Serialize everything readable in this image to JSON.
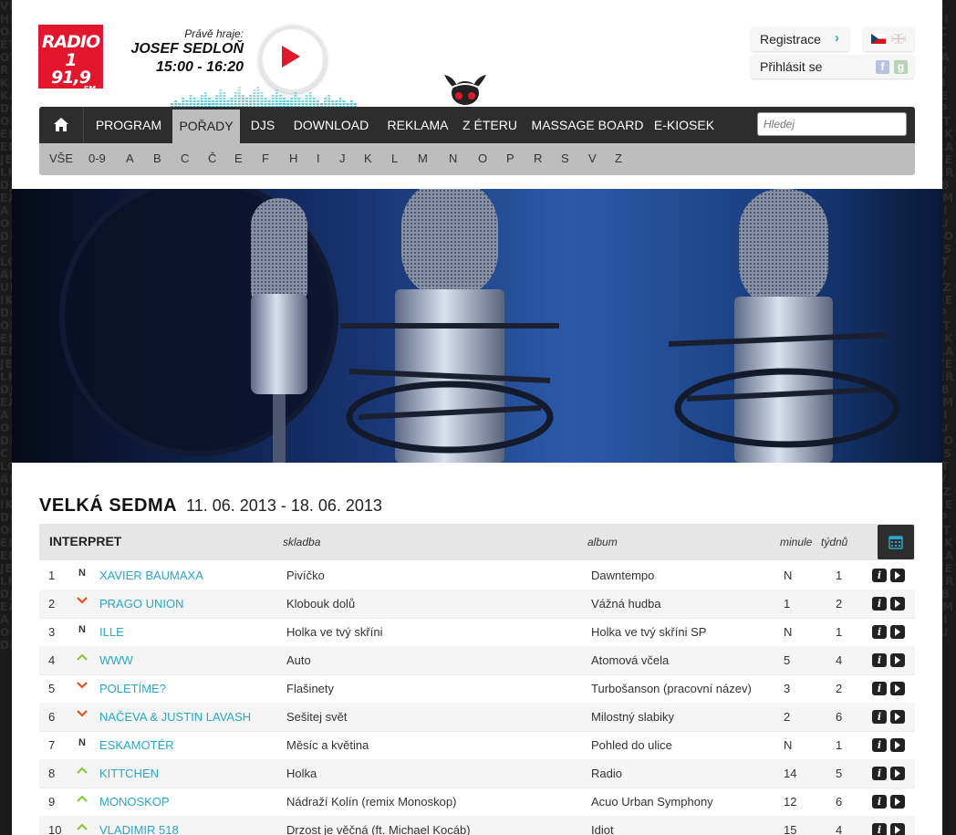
{
  "logo": {
    "line1": "RADIO 1",
    "line2": "91,9",
    "line3": "FM"
  },
  "now_playing": {
    "label": "Právě hraje:",
    "name": "JOSEF SEDLOŇ",
    "time": "15:00 - 16:20"
  },
  "account": {
    "register": "Registrace",
    "login": "Přihlásit se"
  },
  "nav": {
    "items": [
      "PROGRAM",
      "POŘADY",
      "DJS",
      "DOWNLOAD",
      "REKLAMA",
      "Z ÉTERU",
      "MASSAGE BOARD",
      "E-KIOSEK"
    ],
    "active": "POŘADY",
    "search_placeholder": "Hledej"
  },
  "alphabet": [
    "VŠE",
    "0-9",
    "A",
    "B",
    "C",
    "Č",
    "E",
    "F",
    "H",
    "I",
    "J",
    "K",
    "L",
    "M",
    "N",
    "O",
    "P",
    "R",
    "S",
    "V",
    "Z"
  ],
  "chart": {
    "title": "VELKÁ SEDMA",
    "date_range": "11. 06. 2013 - 18. 06. 2013",
    "headers": {
      "artist": "INTERPRET",
      "song": "skladba",
      "album": "album",
      "last": "minule",
      "weeks": "týdnů"
    },
    "rows": [
      {
        "rank": "1",
        "trend": "N",
        "artist": "XAVIER BAUMAXA",
        "song": "Pivíčko",
        "album": "Dawntempo",
        "last": "N",
        "weeks": "1"
      },
      {
        "rank": "2",
        "trend": "down",
        "artist": "PRAGO UNION",
        "song": "Klobouk dolů",
        "album": "Vážná hudba",
        "last": "1",
        "weeks": "2"
      },
      {
        "rank": "3",
        "trend": "N",
        "artist": "ILLE",
        "song": "Holka ve tvý skříni",
        "album": "Holka ve tvý skříni SP",
        "last": "N",
        "weeks": "1"
      },
      {
        "rank": "4",
        "trend": "up",
        "artist": "WWW",
        "song": "Auto",
        "album": "Atomová včela",
        "last": "5",
        "weeks": "4"
      },
      {
        "rank": "5",
        "trend": "down",
        "artist": "POLETÍME?",
        "song": "Flašinety",
        "album": "Turbošanson (pracovní název)",
        "last": "3",
        "weeks": "2"
      },
      {
        "rank": "6",
        "trend": "down",
        "artist": "NAČEVA & JUSTIN LAVASH",
        "song": "Sešitej svět",
        "album": "Milostný slabiky",
        "last": "2",
        "weeks": "6"
      },
      {
        "rank": "7",
        "trend": "N",
        "artist": "ESKAMOTÉR",
        "song": "Měsíc a květina",
        "album": "Pohled do ulice",
        "last": "N",
        "weeks": "1"
      },
      {
        "rank": "8",
        "trend": "up",
        "artist": "KITTCHEN",
        "song": "Holka",
        "album": "Radio",
        "last": "14",
        "weeks": "5"
      },
      {
        "rank": "9",
        "trend": "up",
        "artist": "MONOSKOP",
        "song": "Nádraží Kolín (remix Monoskop)",
        "album": "Acuo Urban Symphony",
        "last": "12",
        "weeks": "6"
      },
      {
        "rank": "10",
        "trend": "up",
        "artist": "VLADIMIR 518",
        "song": "Drzost je věčná (ft. Michael Kocáb)",
        "album": "Idiot",
        "last": "15",
        "weeks": "4"
      }
    ]
  },
  "colors": {
    "brand_red": "#e2162c",
    "link_blue": "#2aa7c9",
    "trend_up": "#8cc63f",
    "trend_down": "#e0541d",
    "nav_dark": "#2d2d2d"
  }
}
